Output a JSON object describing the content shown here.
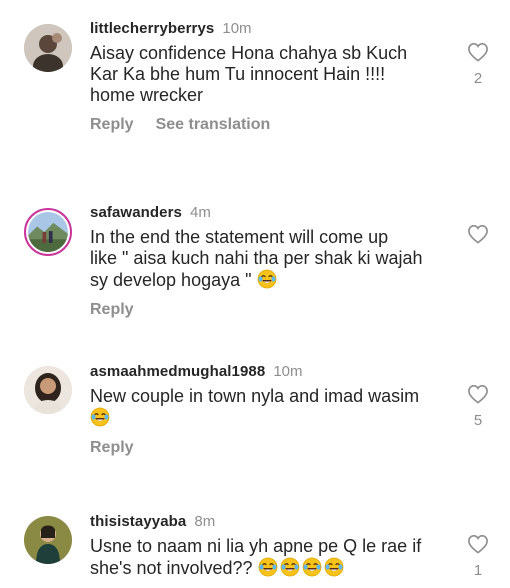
{
  "comments": [
    {
      "username": "littlecherryberrys",
      "time": "10m",
      "text_lines": [
        "Aisay confidence Hona chahya sb Kuch",
        "Kar Ka bhe hum Tu innocent Hain !!!!",
        "home wrecker"
      ],
      "emoji_count": 0,
      "actions": [
        "Reply",
        "See translation"
      ],
      "likes": "2"
    },
    {
      "username": "safawanders",
      "time": "4m",
      "text_lines": [
        "In the end the statement will come up",
        "like \" aisa kuch nahi tha per shak ki wajah",
        "sy develop hogaya \""
      ],
      "emoji_count": 1,
      "actions": [
        "Reply"
      ],
      "likes": ""
    },
    {
      "username": "asmaahmedmughal1988",
      "time": "10m",
      "text_lines": [
        "New couple in town nyla and imad wasim"
      ],
      "emoji_count": 1,
      "actions": [
        "Reply"
      ],
      "likes": "5"
    },
    {
      "username": "thisistayyaba",
      "time": "8m",
      "text_lines": [
        "Usne to naam ni lia yh apne pe Q le rae if",
        "she's not involved??"
      ],
      "emoji_count": 4,
      "actions": [],
      "likes": "1"
    }
  ],
  "icons": {
    "like": "heart-outline-icon",
    "emoji": "laughing-tears-emoji"
  },
  "colors": {
    "username": "#262626",
    "muted": "#8e8e8e",
    "story_ring": "#c9359a"
  }
}
